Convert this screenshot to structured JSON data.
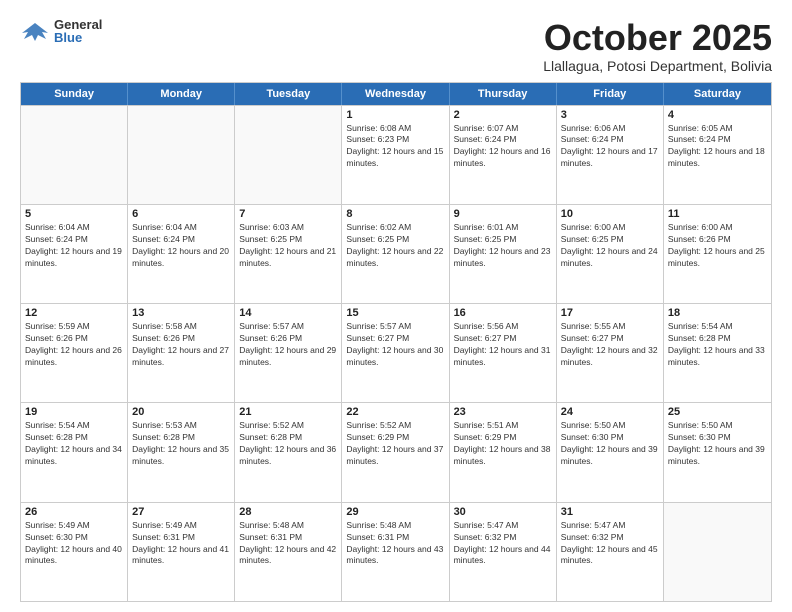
{
  "header": {
    "logo_general": "General",
    "logo_blue": "Blue",
    "month": "October 2025",
    "location": "Llallagua, Potosi Department, Bolivia"
  },
  "weekdays": [
    "Sunday",
    "Monday",
    "Tuesday",
    "Wednesday",
    "Thursday",
    "Friday",
    "Saturday"
  ],
  "weeks": [
    [
      {
        "day": "",
        "sunrise": "",
        "sunset": "",
        "daylight": ""
      },
      {
        "day": "",
        "sunrise": "",
        "sunset": "",
        "daylight": ""
      },
      {
        "day": "",
        "sunrise": "",
        "sunset": "",
        "daylight": ""
      },
      {
        "day": "1",
        "sunrise": "Sunrise: 6:08 AM",
        "sunset": "Sunset: 6:23 PM",
        "daylight": "Daylight: 12 hours and 15 minutes."
      },
      {
        "day": "2",
        "sunrise": "Sunrise: 6:07 AM",
        "sunset": "Sunset: 6:24 PM",
        "daylight": "Daylight: 12 hours and 16 minutes."
      },
      {
        "day": "3",
        "sunrise": "Sunrise: 6:06 AM",
        "sunset": "Sunset: 6:24 PM",
        "daylight": "Daylight: 12 hours and 17 minutes."
      },
      {
        "day": "4",
        "sunrise": "Sunrise: 6:05 AM",
        "sunset": "Sunset: 6:24 PM",
        "daylight": "Daylight: 12 hours and 18 minutes."
      }
    ],
    [
      {
        "day": "5",
        "sunrise": "Sunrise: 6:04 AM",
        "sunset": "Sunset: 6:24 PM",
        "daylight": "Daylight: 12 hours and 19 minutes."
      },
      {
        "day": "6",
        "sunrise": "Sunrise: 6:04 AM",
        "sunset": "Sunset: 6:24 PM",
        "daylight": "Daylight: 12 hours and 20 minutes."
      },
      {
        "day": "7",
        "sunrise": "Sunrise: 6:03 AM",
        "sunset": "Sunset: 6:25 PM",
        "daylight": "Daylight: 12 hours and 21 minutes."
      },
      {
        "day": "8",
        "sunrise": "Sunrise: 6:02 AM",
        "sunset": "Sunset: 6:25 PM",
        "daylight": "Daylight: 12 hours and 22 minutes."
      },
      {
        "day": "9",
        "sunrise": "Sunrise: 6:01 AM",
        "sunset": "Sunset: 6:25 PM",
        "daylight": "Daylight: 12 hours and 23 minutes."
      },
      {
        "day": "10",
        "sunrise": "Sunrise: 6:00 AM",
        "sunset": "Sunset: 6:25 PM",
        "daylight": "Daylight: 12 hours and 24 minutes."
      },
      {
        "day": "11",
        "sunrise": "Sunrise: 6:00 AM",
        "sunset": "Sunset: 6:26 PM",
        "daylight": "Daylight: 12 hours and 25 minutes."
      }
    ],
    [
      {
        "day": "12",
        "sunrise": "Sunrise: 5:59 AM",
        "sunset": "Sunset: 6:26 PM",
        "daylight": "Daylight: 12 hours and 26 minutes."
      },
      {
        "day": "13",
        "sunrise": "Sunrise: 5:58 AM",
        "sunset": "Sunset: 6:26 PM",
        "daylight": "Daylight: 12 hours and 27 minutes."
      },
      {
        "day": "14",
        "sunrise": "Sunrise: 5:57 AM",
        "sunset": "Sunset: 6:26 PM",
        "daylight": "Daylight: 12 hours and 29 minutes."
      },
      {
        "day": "15",
        "sunrise": "Sunrise: 5:57 AM",
        "sunset": "Sunset: 6:27 PM",
        "daylight": "Daylight: 12 hours and 30 minutes."
      },
      {
        "day": "16",
        "sunrise": "Sunrise: 5:56 AM",
        "sunset": "Sunset: 6:27 PM",
        "daylight": "Daylight: 12 hours and 31 minutes."
      },
      {
        "day": "17",
        "sunrise": "Sunrise: 5:55 AM",
        "sunset": "Sunset: 6:27 PM",
        "daylight": "Daylight: 12 hours and 32 minutes."
      },
      {
        "day": "18",
        "sunrise": "Sunrise: 5:54 AM",
        "sunset": "Sunset: 6:28 PM",
        "daylight": "Daylight: 12 hours and 33 minutes."
      }
    ],
    [
      {
        "day": "19",
        "sunrise": "Sunrise: 5:54 AM",
        "sunset": "Sunset: 6:28 PM",
        "daylight": "Daylight: 12 hours and 34 minutes."
      },
      {
        "day": "20",
        "sunrise": "Sunrise: 5:53 AM",
        "sunset": "Sunset: 6:28 PM",
        "daylight": "Daylight: 12 hours and 35 minutes."
      },
      {
        "day": "21",
        "sunrise": "Sunrise: 5:52 AM",
        "sunset": "Sunset: 6:28 PM",
        "daylight": "Daylight: 12 hours and 36 minutes."
      },
      {
        "day": "22",
        "sunrise": "Sunrise: 5:52 AM",
        "sunset": "Sunset: 6:29 PM",
        "daylight": "Daylight: 12 hours and 37 minutes."
      },
      {
        "day": "23",
        "sunrise": "Sunrise: 5:51 AM",
        "sunset": "Sunset: 6:29 PM",
        "daylight": "Daylight: 12 hours and 38 minutes."
      },
      {
        "day": "24",
        "sunrise": "Sunrise: 5:50 AM",
        "sunset": "Sunset: 6:30 PM",
        "daylight": "Daylight: 12 hours and 39 minutes."
      },
      {
        "day": "25",
        "sunrise": "Sunrise: 5:50 AM",
        "sunset": "Sunset: 6:30 PM",
        "daylight": "Daylight: 12 hours and 39 minutes."
      }
    ],
    [
      {
        "day": "26",
        "sunrise": "Sunrise: 5:49 AM",
        "sunset": "Sunset: 6:30 PM",
        "daylight": "Daylight: 12 hours and 40 minutes."
      },
      {
        "day": "27",
        "sunrise": "Sunrise: 5:49 AM",
        "sunset": "Sunset: 6:31 PM",
        "daylight": "Daylight: 12 hours and 41 minutes."
      },
      {
        "day": "28",
        "sunrise": "Sunrise: 5:48 AM",
        "sunset": "Sunset: 6:31 PM",
        "daylight": "Daylight: 12 hours and 42 minutes."
      },
      {
        "day": "29",
        "sunrise": "Sunrise: 5:48 AM",
        "sunset": "Sunset: 6:31 PM",
        "daylight": "Daylight: 12 hours and 43 minutes."
      },
      {
        "day": "30",
        "sunrise": "Sunrise: 5:47 AM",
        "sunset": "Sunset: 6:32 PM",
        "daylight": "Daylight: 12 hours and 44 minutes."
      },
      {
        "day": "31",
        "sunrise": "Sunrise: 5:47 AM",
        "sunset": "Sunset: 6:32 PM",
        "daylight": "Daylight: 12 hours and 45 minutes."
      },
      {
        "day": "",
        "sunrise": "",
        "sunset": "",
        "daylight": ""
      }
    ]
  ]
}
